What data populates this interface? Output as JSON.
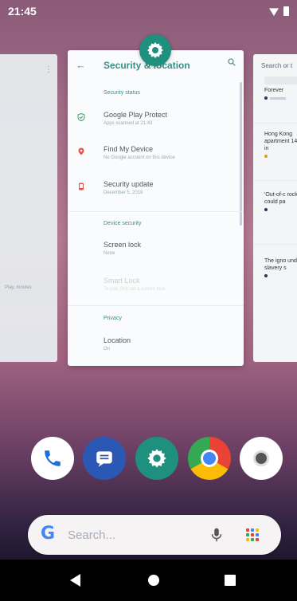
{
  "status_bar": {
    "time": "21:45"
  },
  "settings_card": {
    "title": "Security & location",
    "sections": [
      {
        "label": "Security status"
      },
      {
        "label": "Device security"
      },
      {
        "label": "Privacy"
      }
    ],
    "rows": [
      {
        "title": "Google Play Protect",
        "subtitle": "Apps scanned at 21:43"
      },
      {
        "title": "Find My Device",
        "subtitle": "No Google account on this device"
      },
      {
        "title": "Security update",
        "subtitle": "December 5, 2019"
      },
      {
        "title": "Screen lock",
        "subtitle": "None"
      },
      {
        "title": "Smart Lock",
        "subtitle": "To use, first set a screen lock"
      },
      {
        "title": "Location",
        "subtitle": "On"
      }
    ]
  },
  "right_card": {
    "search": "Search or t",
    "items": [
      {
        "text": "Forever"
      },
      {
        "text": "Hong Kong apartment 14-year in"
      },
      {
        "text": "'Out-of-c rocket fal could pa"
      },
      {
        "text": "The igno undermin slavery s"
      }
    ]
  },
  "left_card": {
    "faint_text": "Play, movies"
  },
  "search_bar": {
    "placeholder": "Search..."
  },
  "colors": {
    "accent": "#1f8f7e",
    "phone": "#1e6fd9",
    "messages": "#2b57b5"
  }
}
